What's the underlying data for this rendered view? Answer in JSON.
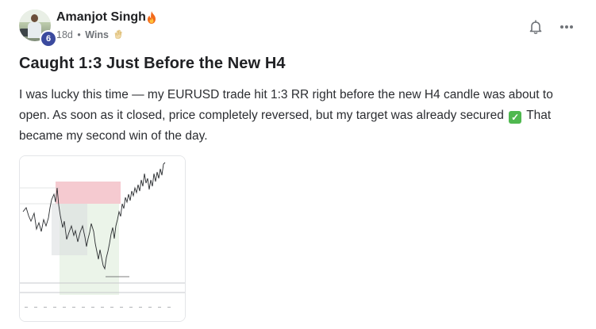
{
  "author": {
    "name": "Amanjot Singh",
    "level": "6"
  },
  "meta": {
    "age": "18d",
    "separator": "•",
    "category": "Wins"
  },
  "post": {
    "title": "Caught 1:3 Just Before the New H4",
    "body_part1": "I was lucky this time — my EURUSD trade hit 1:3 RR right before the new H4 candle was about to open. As soon as it closed, price completely reversed, but my target was already secured",
    "body_part2": "That became my second win of the day."
  },
  "icons": [
    "fire-icon",
    "clap-icon",
    "bell-icon",
    "more-icon",
    "check-icon"
  ],
  "colors": {
    "level_badge": "#3b4a9e",
    "check": "#4fb84f",
    "stop_zone": "#f2b8c0",
    "profit_zone": "#e3f0e0"
  }
}
